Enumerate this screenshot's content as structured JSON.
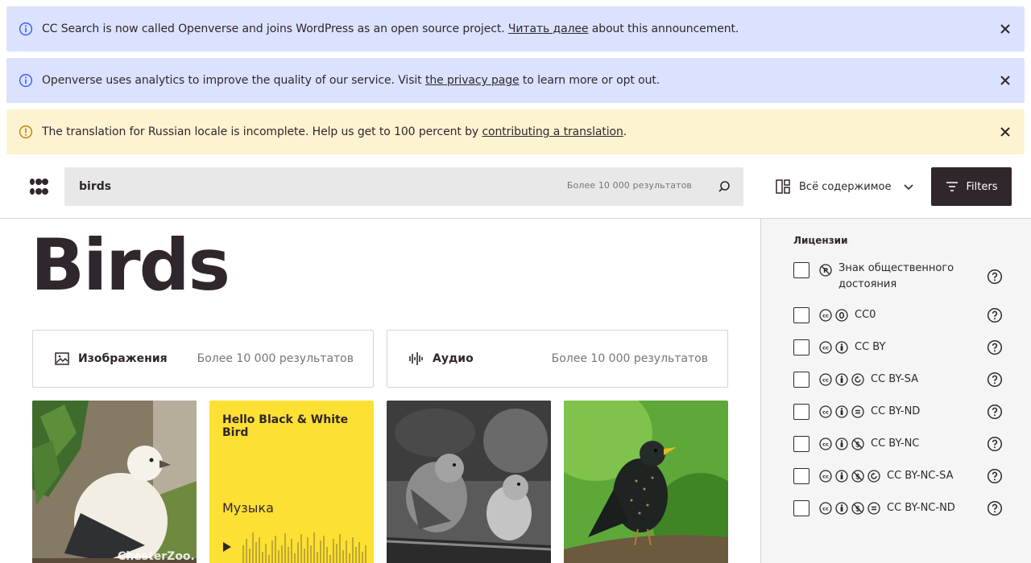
{
  "banners": [
    {
      "kind": "info",
      "before": "CC Search is now called Openverse and joins WordPress as an open source project. ",
      "link": "Читать далее",
      "after": " about this announcement."
    },
    {
      "kind": "info",
      "before": "Openverse uses analytics to improve the quality of our service. Visit ",
      "link": "the privacy page",
      "after": " to learn more or opt out."
    },
    {
      "kind": "warn",
      "before": "The translation for Russian locale is incomplete. Help us get to 100 percent by ",
      "link": "contributing a translation",
      "after": "."
    }
  ],
  "header": {
    "search_value": "birds",
    "search_count": "Более 10 000 результатов",
    "content_type": "Всё содержимое",
    "filters_label": "Filters"
  },
  "main": {
    "title": "Birds",
    "cards": [
      {
        "label": "Изображения",
        "count": "Более 10 000 результатов"
      },
      {
        "label": "Аудио",
        "count": "Более 10 000 результатов"
      }
    ],
    "audio": {
      "title": "Hello Black & White Bird",
      "genre": "Музыка"
    },
    "image_watermark": "ChesterZoo."
  },
  "sidebar": {
    "heading": "Лицензии",
    "licenses": [
      {
        "name": "Знак общественного достояния",
        "icons": [
          "pdm-icon"
        ]
      },
      {
        "name": "CC0",
        "icons": [
          "cc-icon",
          "zero-icon"
        ]
      },
      {
        "name": "CC BY",
        "icons": [
          "cc-icon",
          "by-icon"
        ]
      },
      {
        "name": "CC BY-SA",
        "icons": [
          "cc-icon",
          "by-icon",
          "sa-icon"
        ]
      },
      {
        "name": "CC BY-ND",
        "icons": [
          "cc-icon",
          "by-icon",
          "nd-icon"
        ]
      },
      {
        "name": "CC BY-NC",
        "icons": [
          "cc-icon",
          "by-icon",
          "nc-icon"
        ]
      },
      {
        "name": "CC BY-NC-SA",
        "icons": [
          "cc-icon",
          "by-icon",
          "nc-icon",
          "sa-icon"
        ]
      },
      {
        "name": "CC BY-NC-ND",
        "icons": [
          "cc-icon",
          "by-icon",
          "nc-icon",
          "nd-icon"
        ]
      }
    ]
  },
  "colors": {
    "info_bg": "#dbe2fe",
    "warn_bg": "#fef3d1",
    "dark": "#30272e",
    "audio_yellow": "#fde034"
  }
}
